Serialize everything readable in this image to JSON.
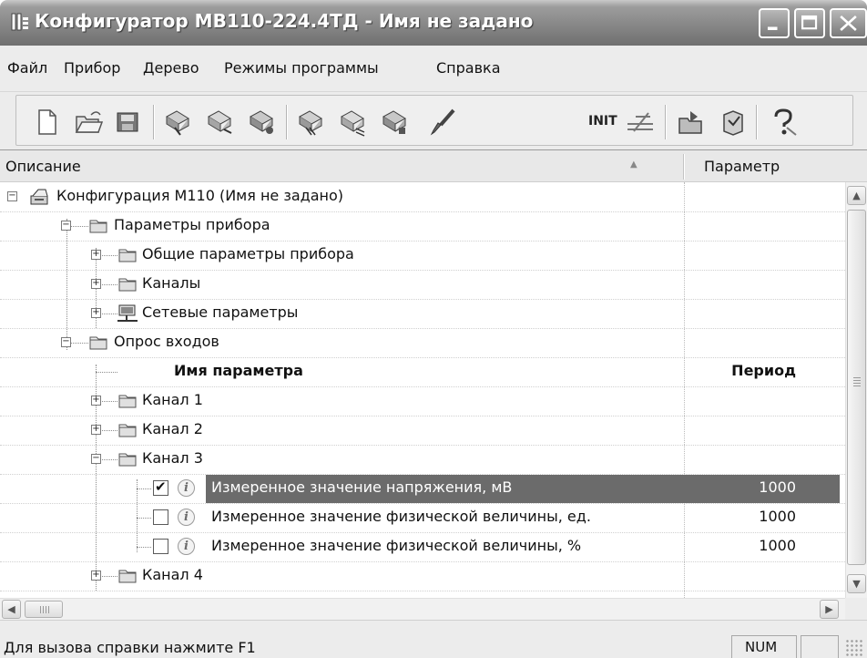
{
  "window": {
    "title": "Конфигуратор МВ110-224.4ТД - Имя не задано"
  },
  "menu": [
    {
      "label": "Файл"
    },
    {
      "label": "Прибор"
    },
    {
      "label": "Дерево"
    },
    {
      "label": "Режимы программы"
    },
    {
      "label": "Справка"
    }
  ],
  "toolbar": {
    "init_label": "INIT",
    "tools": [
      "new-file-icon",
      "open-folder-icon",
      "save-icon",
      "read-device-icon",
      "write-device-icon",
      "compare-icon",
      "read-all-icon",
      "write-all-icon",
      "copy-settings-icon",
      "brush-icon",
      "init-icon",
      "network-icon",
      "export-icon",
      "import-icon",
      "help-icon"
    ]
  },
  "columns": {
    "description": "Описание",
    "parameter": "Параметр"
  },
  "tree": {
    "root": "Конфигурация М110 (Имя не задано)",
    "device_params": "Параметры прибора",
    "general_params": "Общие параметры прибора",
    "channels": "Каналы",
    "network_params": "Сетевые параметры",
    "input_poll": "Опрос входов",
    "table_header_name": "Имя параметра",
    "table_header_period": "Период",
    "channel_1": "Канал  1",
    "channel_2": "Канал  2",
    "channel_3": "Канал  3",
    "params": [
      {
        "label": "Измеренное значение напряжения, мВ",
        "value": "1000",
        "checked": true
      },
      {
        "label": "Измеренное значение физической величины, ед.",
        "value": "1000",
        "checked": false
      },
      {
        "label": "Измеренное значение физической величины, %",
        "value": "1000",
        "checked": false
      }
    ],
    "channel_4": "Канал  4"
  },
  "status": {
    "hint": "Для вызова справки нажмите F1",
    "num": "NUM"
  }
}
